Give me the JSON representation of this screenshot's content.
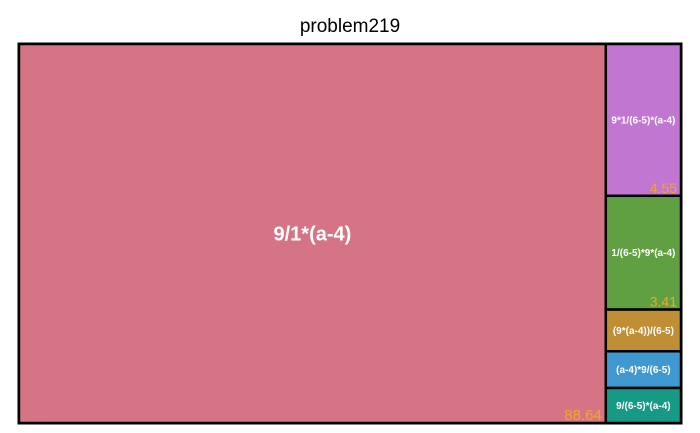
{
  "chart_data": {
    "type": "treemap",
    "title": "problem219",
    "items": [
      {
        "label": "9/1*(a-4)",
        "value": 88.64,
        "value_label": "88.64",
        "color": "#d57485"
      },
      {
        "label": "9*1/(6-5)*(a-4)",
        "value": 4.55,
        "value_label": "4.55",
        "color": "#c177d2"
      },
      {
        "label": "1/(6-5)*9*(a-4)",
        "value": 3.41,
        "value_label": "3.41",
        "color": "#61a042"
      },
      {
        "label": "(9*(a-4))/(6-5)",
        "value": 1.25,
        "value_label": "",
        "color": "#bf8e35"
      },
      {
        "label": "(a-4)*9/(6-5)",
        "value": 1.1,
        "value_label": "",
        "color": "#3f98cf"
      },
      {
        "label": "9/(6-5)*(a-4)",
        "value": 1.05,
        "value_label": "",
        "color": "#169a85"
      }
    ],
    "value_label_color": "#f5a623",
    "label_color": "#ffffff",
    "border_color": "#000000"
  }
}
